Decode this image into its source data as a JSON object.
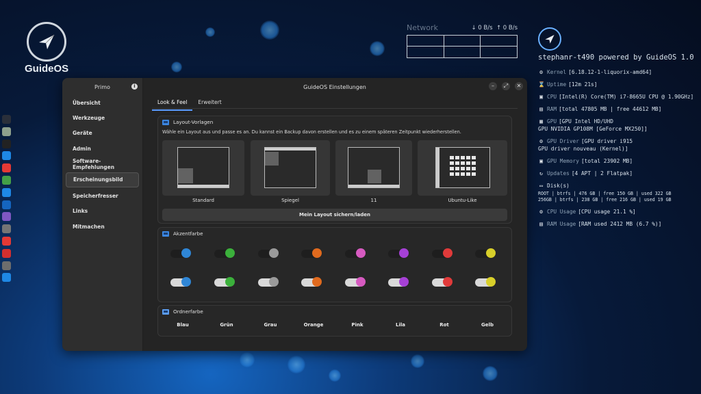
{
  "desktop": {
    "logo_text": "GuideOS",
    "dock": [
      {
        "name": "guideos-icon",
        "color": "#2a2f3a"
      },
      {
        "name": "files-icon",
        "color": "#8ea08d"
      },
      {
        "name": "terminal-icon",
        "color": "#222222"
      },
      {
        "name": "browser-icon",
        "color": "#1e88e5"
      },
      {
        "name": "video-icon",
        "color": "#e53935"
      },
      {
        "name": "settings-icon",
        "color": "#43a047"
      },
      {
        "name": "chat-icon",
        "color": "#1e88e5"
      },
      {
        "name": "firefox-icon",
        "color": "#1565c0"
      },
      {
        "name": "mail-icon",
        "color": "#7e57c2"
      },
      {
        "name": "trash-icon",
        "color": "#757575"
      },
      {
        "name": "vivaldi-icon",
        "color": "#e53935"
      },
      {
        "name": "shield-app-icon",
        "color": "#d32f2f"
      },
      {
        "name": "gimp-icon",
        "color": "#6d6d6d"
      },
      {
        "name": "gear-app-icon",
        "color": "#1e88e5"
      }
    ]
  },
  "network": {
    "title": "Network",
    "down": "↓ 0 B/s",
    "up": "↑ 0 B/s"
  },
  "conky": {
    "hostline": "stephanr-t490 powered by GuideOS 1.0",
    "kernel_label": "Kernel",
    "kernel": "[6.18.12-1-liquorix-amd64]",
    "uptime_label": "Uptime",
    "uptime": "[12m 21s]",
    "cpu_label": "CPU",
    "cpu": "[Intel(R) Core(TM) i7-8665U CPU @ 1.90GHz]",
    "ram_label": "RAM",
    "ram": "[total 47805 MB | free 44612 MB]",
    "gpu_label": "GPU",
    "gpu": "[GPU Intel HD/UHD",
    "gpu2": "GPU NVIDIA GP108M [GeForce MX250]]",
    "driver_label": "GPU Driver",
    "driver": "[GPU driver i915",
    "driver2": "GPU driver nouveau (Kernel)]",
    "gmem_label": "GPU Memory",
    "gmem": "[total 23902 MB]",
    "updates_label": "Updates",
    "updates": "[4 APT | 2 Flatpak]",
    "disk_label": "Disk(s)",
    "disk1": "ROOT | btrfs | 476 GB | free 150 GB | used 322 GB",
    "disk2": "256GB | btrfs | 238 GB | free 216 GB | used 19 GB",
    "cpuusage_label": "CPU Usage",
    "cpuusage": "[CPU usage 21.1 %]",
    "ramusage_label": "RAM Usage",
    "ramusage": "[RAM used 2412 MB (6.7 %)]"
  },
  "window": {
    "title": "GuideOS Einstellungen",
    "sidebar_header": "Primo",
    "sidebar": [
      "Übersicht",
      "Werkzeuge",
      "Geräte",
      "Admin",
      "Software-Empfehlungen",
      "Erscheinungsbild",
      "Speicherfresser",
      "Links",
      "Mitmachen"
    ],
    "active_index": 5,
    "tabs": [
      "Look & Feel",
      "Erweitert"
    ],
    "layout": {
      "title": "Layout-Vorlagen",
      "desc": "Wähle ein Layout aus und passe es an. Du kannst ein Backup davon erstellen und es zu einem späteren Zeitpunkt wiederherstellen.",
      "templates": [
        "Standard",
        "Spiegel",
        "11",
        "Ubuntu-Like"
      ],
      "save_button": "Mein Layout sichern/laden"
    },
    "accent": {
      "title": "Akzentfarbe",
      "colors": [
        "#2f86d6",
        "#3bb03b",
        "#9a9a9a",
        "#e06a1e",
        "#d65ac0",
        "#a640d6",
        "#e03a3a",
        "#d8cf2a"
      ]
    },
    "folder": {
      "title": "Ordnerfarbe",
      "names": [
        "Blau",
        "Grün",
        "Grau",
        "Orange",
        "Pink",
        "Lila",
        "Rot",
        "Gelb"
      ]
    }
  }
}
